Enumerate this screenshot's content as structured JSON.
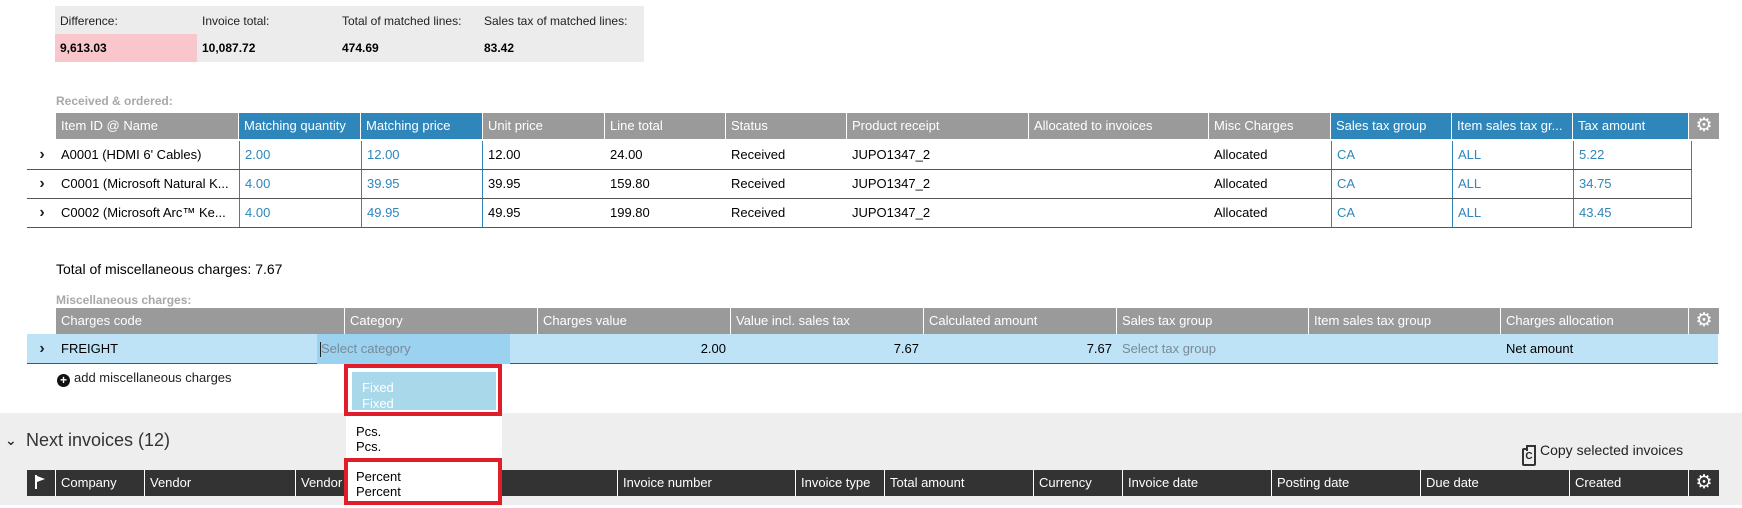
{
  "summary": {
    "difference_label": "Difference:",
    "difference_value": "9,613.03",
    "invoice_total_label": "Invoice total:",
    "invoice_total_value": "10,087.72",
    "matched_lines_label": "Total of matched lines:",
    "matched_lines_value": "474.69",
    "sales_tax_label": "Sales tax of matched lines:",
    "sales_tax_value": "83.42"
  },
  "received": {
    "section_label": "Received & ordered:",
    "columns": [
      "Item ID @ Name",
      "Matching quantity",
      "Matching price",
      "Unit price",
      "Line total",
      "Status",
      "Product receipt",
      "Allocated to invoices",
      "Misc Charges",
      "Sales tax group",
      "Item sales tax gr...",
      "Tax amount"
    ],
    "rows": [
      [
        "A0001 (HDMI 6' Cables)",
        "2.00",
        "12.00",
        "12.00",
        "24.00",
        "Received",
        "JUPO1347_2",
        "",
        "Allocated",
        "CA",
        "ALL",
        "5.22"
      ],
      [
        "C0001 (Microsoft Natural K...",
        "4.00",
        "39.95",
        "39.95",
        "159.80",
        "Received",
        "JUPO1347_2",
        "",
        "Allocated",
        "CA",
        "ALL",
        "34.75"
      ],
      [
        "C0002 (Microsoft Arc™ Ke...",
        "4.00",
        "49.95",
        "49.95",
        "199.80",
        "Received",
        "JUPO1347_2",
        "",
        "Allocated",
        "CA",
        "ALL",
        "43.45"
      ]
    ]
  },
  "misc": {
    "total_text": "Total of miscellaneous charges: 7.67",
    "section_label": "Miscellaneous charges:",
    "columns": [
      "Charges code",
      "Category",
      "Charges value",
      "Value incl. sales tax",
      "Calculated amount",
      "Sales tax group",
      "Item sales tax group",
      "Charges allocation"
    ],
    "row": {
      "code": "FREIGHT",
      "category_placeholder": "Select category",
      "charges_value": "2.00",
      "value_incl_tax": "7.67",
      "calculated_amount": "7.67",
      "sales_tax_placeholder": "Select tax group",
      "item_sales_tax_group": "",
      "charges_allocation": "Net amount"
    },
    "add_label": "add miscellaneous charges"
  },
  "dropdown": {
    "options": [
      {
        "line1": "Fixed",
        "line2": "Fixed"
      },
      {
        "line1": "Pcs.",
        "line2": "Pcs."
      },
      {
        "line1": "Percent",
        "line2": "Percent"
      }
    ]
  },
  "next_invoices": {
    "title": "Next invoices (12)",
    "copy_label": "Copy selected invoices",
    "columns": [
      "Company",
      "Vendor",
      "Vendor",
      "Invoice number",
      "Invoice type",
      "Total amount",
      "Currency",
      "Invoice date",
      "Posting date",
      "Due date",
      "Created"
    ]
  },
  "colors": {
    "header_gray": "#9a9a9a",
    "header_blue": "#2e86bb",
    "header_dark": "#333333",
    "difference_bg": "#f8c6cb",
    "selected_row": "#bfe3f6",
    "highlight": "#e01d2a"
  }
}
